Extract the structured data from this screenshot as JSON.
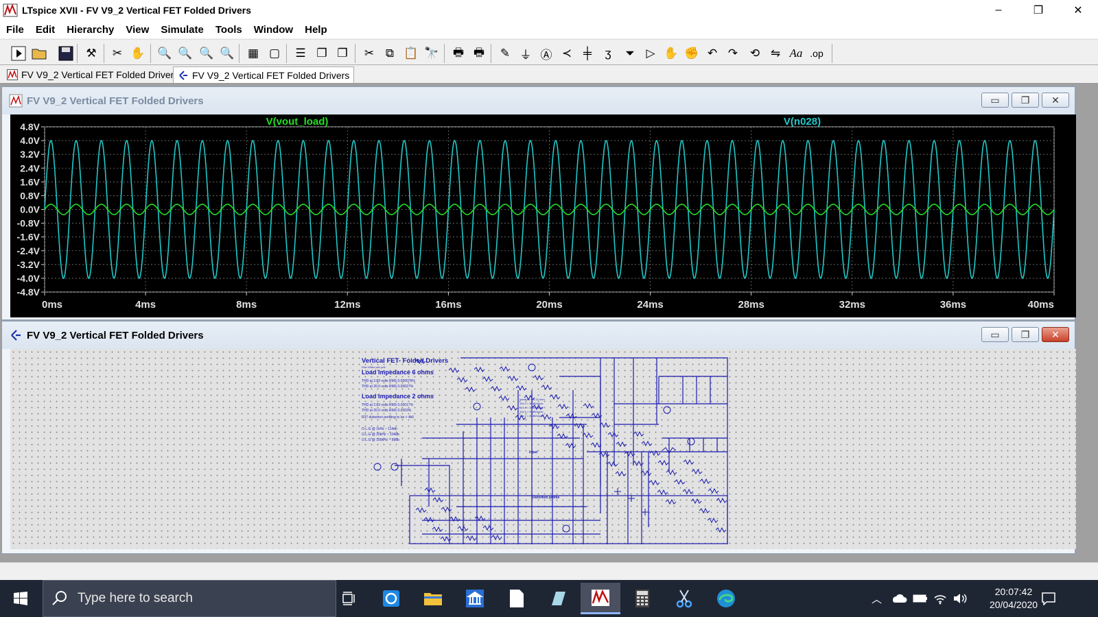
{
  "app": {
    "title": "LTspice XVII - FV V9_2 Vertical FET Folded Drivers",
    "window_buttons": [
      "–",
      "❐",
      "✕"
    ]
  },
  "menu": [
    "File",
    "Edit",
    "Hierarchy",
    "View",
    "Simulate",
    "Tools",
    "Window",
    "Help"
  ],
  "toolbar_icons": [
    "run-icon",
    "open-icon",
    "save-icon",
    "control-panel-icon",
    "halt-icon",
    "pan-icon",
    "zoom-in-icon",
    "zoom-area-icon",
    "zoom-out-icon",
    "zoom-cancel-icon",
    "autorange-icon",
    "rubber-band-icon",
    "tile-horizontal-icon",
    "cascade-icon",
    "tile-vertical-icon",
    "cut-icon",
    "copy-icon",
    "paste-icon",
    "find-icon",
    "print-icon",
    "print-setup-icon",
    "draw-wire-icon",
    "ground-icon",
    "label-net-icon",
    "resistor-icon",
    "capacitor-icon",
    "inductor-icon",
    "diode-icon",
    "component-icon",
    "move-icon",
    "drag-icon",
    "undo-icon",
    "redo-icon",
    "rotate-icon",
    "mirror-icon",
    "text-icon",
    "spice-directive-icon"
  ],
  "toolbar_glyph_text": {
    "text": "Aa",
    "op": ".op"
  },
  "tabs": [
    {
      "label": "FV V9_2 Vertical FET Folded Drivers",
      "type": "waveform"
    },
    {
      "label": "FV V9_2 Vertical FET Folded Drivers",
      "type": "schematic"
    }
  ],
  "plot_window": {
    "title": "FV V9_2 Vertical FET Folded Drivers",
    "buttons": [
      "▭",
      "❐",
      "✕"
    ]
  },
  "schematic_window": {
    "title": "FV V9_2 Vertical FET Folded Drivers",
    "buttons": [
      "▭",
      "❐",
      "✕"
    ],
    "notes": {
      "title": "Vertical FET- Folded Drivers",
      "sub": "20w 100hz  pd1 pd1",
      "load6": "Load Impedance 6 ohms",
      "thd6a": "THD at 2.83 volts RMS 0.000076%",
      "thd6b": "THD at 20.0 volts RMS 0.00027%",
      "load2": "Load Impedance 2 ohms",
      "thd2a": "THD at 2.83 volts RMS 0.00017%",
      "thd2b": "THD at 20.0 volts RMS 0.0003%",
      "r37": "R37 distortion profiling to be > 4k5",
      "olg1": "O.L.G @     1kHz ~ 114db",
      "olg2": "O.L.G @   20kHz ~ 104db",
      "olg3": "O.L.G @ 100kHz ~   89db",
      "input": "Input",
      "distortion": "Distortion profile",
      "spec1": "Ipeak/Av = 0.22 ohm",
      "spec2": "110.0 = 30dB/n/pdc",
      "spec3": "113.4 = 30dB/n/pdc",
      "spec4": "114.5 = 30dB/n/pdc",
      "spec5": "116.2 = 30dB/n/pdc"
    }
  },
  "chart_data": {
    "type": "line",
    "xlabel": "",
    "ylabel": "",
    "x_ticks": [
      "0ms",
      "4ms",
      "8ms",
      "12ms",
      "16ms",
      "20ms",
      "24ms",
      "28ms",
      "32ms",
      "36ms",
      "40ms"
    ],
    "y_ticks": [
      "4.8V",
      "4.0V",
      "3.2V",
      "2.4V",
      "1.6V",
      "0.8V",
      "0.0V",
      "-0.8V",
      "-1.6V",
      "-2.4V",
      "-3.2V",
      "-4.0V",
      "-4.8V"
    ],
    "xlim": [
      0,
      40
    ],
    "ylim": [
      -4.8,
      4.8
    ],
    "x_unit": "ms",
    "grid": true,
    "series": [
      {
        "name": "V(vout_load)",
        "color": "#22e022",
        "waveform": "sine",
        "frequency_hz": 1000,
        "amplitude_v": 0.3,
        "offset_v": 0.0
      },
      {
        "name": "V(n028)",
        "color": "#22c8c8",
        "waveform": "sine",
        "frequency_hz": 1000,
        "amplitude_v": 4.0,
        "offset_v": 0.0
      }
    ]
  },
  "taskbar": {
    "search_placeholder": "Type here to search",
    "pinned": [
      "task-view-icon",
      "sync-app-icon",
      "file-explorer-icon",
      "bank-app-icon",
      "document-icon",
      "paint-app-icon",
      "ltspice-icon",
      "calculator-icon",
      "snipping-tool-icon",
      "edge-icon"
    ],
    "active": "ltspice-icon",
    "time": "20:07:42",
    "date": "20/04/2020"
  }
}
